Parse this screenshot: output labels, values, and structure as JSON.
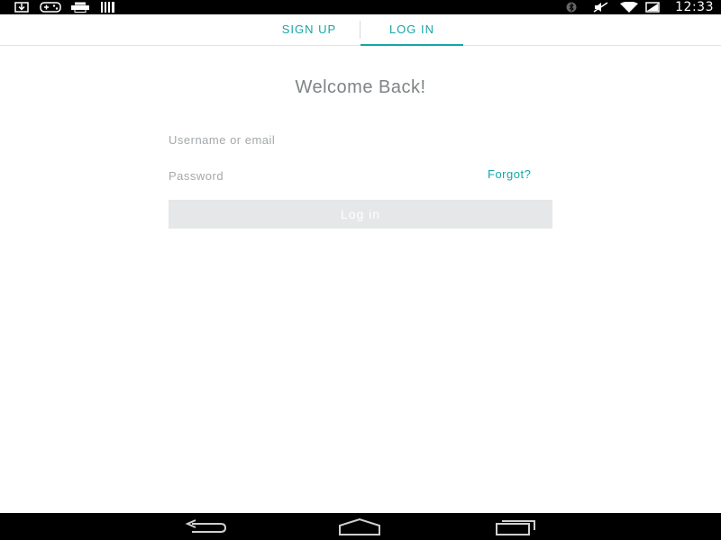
{
  "status_bar": {
    "left_icons": [
      "download-icon",
      "controller-icon",
      "printer-icon",
      "barcode-icon"
    ],
    "right_icons": [
      "bluetooth-icon",
      "mute-icon",
      "wifi-icon",
      "battery-icon"
    ],
    "time": "12:33"
  },
  "tabs": {
    "items": [
      {
        "label": "SIGN UP",
        "active": false
      },
      {
        "label": "LOG IN",
        "active": true
      }
    ]
  },
  "form": {
    "title": "Welcome Back!",
    "username_placeholder": "Username or email",
    "password_placeholder": "Password",
    "forgot_label": "Forgot?",
    "submit_label": "Log in"
  },
  "nav_bar": {
    "buttons": [
      "back-icon",
      "home-icon",
      "recents-icon"
    ]
  },
  "colors": {
    "accent": "#16a6a6",
    "title": "#7e8486",
    "placeholder": "#a4a8aa",
    "button_bg": "#e6e7e8"
  }
}
